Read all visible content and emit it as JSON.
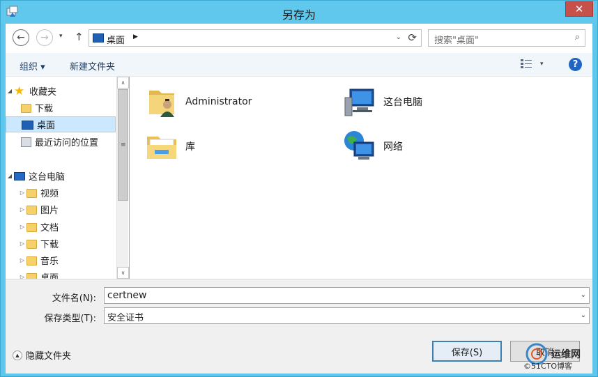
{
  "window": {
    "title": "另存为",
    "close_glyph": "✕"
  },
  "nav": {
    "back_glyph": "←",
    "forward_glyph": "→",
    "history_glyph": "▾",
    "up_glyph": "↑",
    "address_label": "桌面",
    "address_sep": "▶",
    "address_drop": "⌄",
    "refresh_glyph": "⟳",
    "search_placeholder": "搜索\"桌面\"",
    "search_glyph": "⌕"
  },
  "toolbar": {
    "organize_label": "组织 ▾",
    "new_folder_label": "新建文件夹",
    "view_drop_glyph": "▾",
    "help_glyph": "?"
  },
  "tree": {
    "items": [
      {
        "label": "收藏夹",
        "expander": "◢",
        "icon": "star-icon"
      },
      {
        "label": "下载",
        "expander": "",
        "icon": "download-folder-icon"
      },
      {
        "label": "桌面",
        "expander": "",
        "icon": "desktop-icon"
      },
      {
        "label": "最近访问的位置",
        "expander": "",
        "icon": "recent-places-icon"
      },
      {
        "label": "这台电脑",
        "expander": "◢",
        "icon": "computer-icon"
      },
      {
        "label": "视频",
        "expander": "▷",
        "icon": "videos-folder-icon"
      },
      {
        "label": "图片",
        "expander": "▷",
        "icon": "pictures-folder-icon"
      },
      {
        "label": "文档",
        "expander": "▷",
        "icon": "documents-folder-icon"
      },
      {
        "label": "下载",
        "expander": "▷",
        "icon": "download-folder-icon"
      },
      {
        "label": "音乐",
        "expander": "▷",
        "icon": "music-folder-icon"
      },
      {
        "label": "桌面",
        "expander": "▷",
        "icon": "desktop-folder-icon"
      }
    ],
    "scroll_up": "∧",
    "scroll_down": "∨",
    "thumb_grip": "≡"
  },
  "content": {
    "items": [
      {
        "label": "Administrator",
        "icon": "user-folder-icon"
      },
      {
        "label": "这台电脑",
        "icon": "computer-icon"
      },
      {
        "label": "库",
        "icon": "libraries-icon"
      },
      {
        "label": "网络",
        "icon": "network-icon"
      }
    ]
  },
  "form": {
    "filename_label": "文件名(N):",
    "filename_value": "certnew",
    "filetype_label": "保存类型(T):",
    "filetype_value": "安全证书",
    "drop_glyph": "⌄",
    "hide_folders_label": "隐藏文件夹",
    "hide_glyph": "▲",
    "save_label": "保存(S)",
    "cancel_label": "取消"
  },
  "watermark": {
    "line1": "运维网",
    "line2": "©51CTO博客"
  },
  "colors": {
    "titlebar": "#60c8ec",
    "close": "#c7504b",
    "selection": "#cce8ff",
    "toolbar": "#f1f6fb"
  }
}
